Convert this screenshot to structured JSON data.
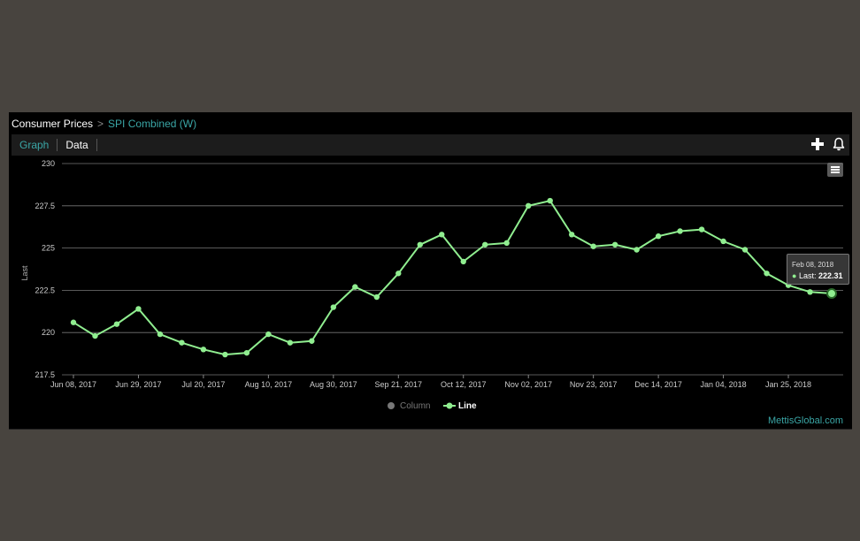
{
  "breadcrumb": {
    "parent": "Consumer Prices",
    "separator": ">",
    "current": "SPI Combined (W)"
  },
  "tabs": [
    {
      "label": "Graph",
      "active": true
    },
    {
      "label": "Data",
      "active": false
    }
  ],
  "toolbar": {
    "add_icon": "plus-icon",
    "alert_icon": "bell-icon",
    "menu_icon": "hamburger-menu-icon"
  },
  "tooltip": {
    "date": "Feb 08, 2018",
    "label": "Last:",
    "value": "222.31"
  },
  "brand": "MettisGlobal.com",
  "colors": {
    "line": "#90ee90",
    "accent": "#3aa6a6",
    "grid": "#777777",
    "column_legend": "#777777"
  },
  "chart_data": {
    "type": "line",
    "ylabel": "Last",
    "ylim": [
      217.5,
      230
    ],
    "yticks": [
      "217.5",
      "220",
      "222.5",
      "225",
      "227.5",
      "230"
    ],
    "xtick_labels": [
      "Jun 08, 2017",
      "Jun 29, 2017",
      "Jul 20, 2017",
      "Aug 10, 2017",
      "Aug 30, 2017",
      "Sep 21, 2017",
      "Oct 12, 2017",
      "Nov 02, 2017",
      "Nov 23, 2017",
      "Dec 14, 2017",
      "Jan 04, 2018",
      "Jan 25, 2018"
    ],
    "grid": true,
    "legend": {
      "placement": "bottom-center",
      "items": [
        {
          "name": "Column",
          "visible": false
        },
        {
          "name": "Line",
          "visible": true
        }
      ]
    },
    "series": [
      {
        "name": "Line",
        "values": [
          220.6,
          219.8,
          220.5,
          221.4,
          219.9,
          219.4,
          219.0,
          218.7,
          218.8,
          219.9,
          219.4,
          219.5,
          221.5,
          222.7,
          222.1,
          223.5,
          225.2,
          225.8,
          224.2,
          225.2,
          225.3,
          227.5,
          227.8,
          225.8,
          225.1,
          225.2,
          224.9,
          225.7,
          226.0,
          226.1,
          225.4,
          224.9,
          223.5,
          222.8,
          222.4,
          222.31
        ]
      }
    ]
  }
}
